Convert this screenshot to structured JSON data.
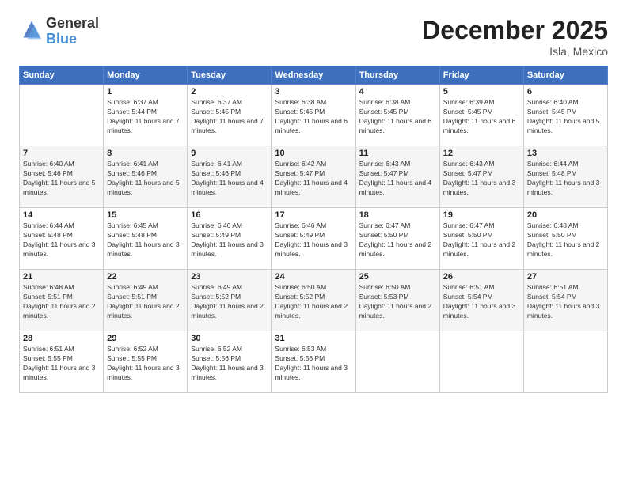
{
  "logo": {
    "general": "General",
    "blue": "Blue"
  },
  "title": "December 2025",
  "location": "Isla, Mexico",
  "days_header": [
    "Sunday",
    "Monday",
    "Tuesday",
    "Wednesday",
    "Thursday",
    "Friday",
    "Saturday"
  ],
  "weeks": [
    [
      {
        "day": "",
        "sunrise": "",
        "sunset": "",
        "daylight": ""
      },
      {
        "day": "1",
        "sunrise": "Sunrise: 6:37 AM",
        "sunset": "Sunset: 5:44 PM",
        "daylight": "Daylight: 11 hours and 7 minutes."
      },
      {
        "day": "2",
        "sunrise": "Sunrise: 6:37 AM",
        "sunset": "Sunset: 5:45 PM",
        "daylight": "Daylight: 11 hours and 7 minutes."
      },
      {
        "day": "3",
        "sunrise": "Sunrise: 6:38 AM",
        "sunset": "Sunset: 5:45 PM",
        "daylight": "Daylight: 11 hours and 6 minutes."
      },
      {
        "day": "4",
        "sunrise": "Sunrise: 6:38 AM",
        "sunset": "Sunset: 5:45 PM",
        "daylight": "Daylight: 11 hours and 6 minutes."
      },
      {
        "day": "5",
        "sunrise": "Sunrise: 6:39 AM",
        "sunset": "Sunset: 5:45 PM",
        "daylight": "Daylight: 11 hours and 6 minutes."
      },
      {
        "day": "6",
        "sunrise": "Sunrise: 6:40 AM",
        "sunset": "Sunset: 5:45 PM",
        "daylight": "Daylight: 11 hours and 5 minutes."
      }
    ],
    [
      {
        "day": "7",
        "sunrise": "Sunrise: 6:40 AM",
        "sunset": "Sunset: 5:46 PM",
        "daylight": "Daylight: 11 hours and 5 minutes."
      },
      {
        "day": "8",
        "sunrise": "Sunrise: 6:41 AM",
        "sunset": "Sunset: 5:46 PM",
        "daylight": "Daylight: 11 hours and 5 minutes."
      },
      {
        "day": "9",
        "sunrise": "Sunrise: 6:41 AM",
        "sunset": "Sunset: 5:46 PM",
        "daylight": "Daylight: 11 hours and 4 minutes."
      },
      {
        "day": "10",
        "sunrise": "Sunrise: 6:42 AM",
        "sunset": "Sunset: 5:47 PM",
        "daylight": "Daylight: 11 hours and 4 minutes."
      },
      {
        "day": "11",
        "sunrise": "Sunrise: 6:43 AM",
        "sunset": "Sunset: 5:47 PM",
        "daylight": "Daylight: 11 hours and 4 minutes."
      },
      {
        "day": "12",
        "sunrise": "Sunrise: 6:43 AM",
        "sunset": "Sunset: 5:47 PM",
        "daylight": "Daylight: 11 hours and 3 minutes."
      },
      {
        "day": "13",
        "sunrise": "Sunrise: 6:44 AM",
        "sunset": "Sunset: 5:48 PM",
        "daylight": "Daylight: 11 hours and 3 minutes."
      }
    ],
    [
      {
        "day": "14",
        "sunrise": "Sunrise: 6:44 AM",
        "sunset": "Sunset: 5:48 PM",
        "daylight": "Daylight: 11 hours and 3 minutes."
      },
      {
        "day": "15",
        "sunrise": "Sunrise: 6:45 AM",
        "sunset": "Sunset: 5:48 PM",
        "daylight": "Daylight: 11 hours and 3 minutes."
      },
      {
        "day": "16",
        "sunrise": "Sunrise: 6:46 AM",
        "sunset": "Sunset: 5:49 PM",
        "daylight": "Daylight: 11 hours and 3 minutes."
      },
      {
        "day": "17",
        "sunrise": "Sunrise: 6:46 AM",
        "sunset": "Sunset: 5:49 PM",
        "daylight": "Daylight: 11 hours and 3 minutes."
      },
      {
        "day": "18",
        "sunrise": "Sunrise: 6:47 AM",
        "sunset": "Sunset: 5:50 PM",
        "daylight": "Daylight: 11 hours and 2 minutes."
      },
      {
        "day": "19",
        "sunrise": "Sunrise: 6:47 AM",
        "sunset": "Sunset: 5:50 PM",
        "daylight": "Daylight: 11 hours and 2 minutes."
      },
      {
        "day": "20",
        "sunrise": "Sunrise: 6:48 AM",
        "sunset": "Sunset: 5:50 PM",
        "daylight": "Daylight: 11 hours and 2 minutes."
      }
    ],
    [
      {
        "day": "21",
        "sunrise": "Sunrise: 6:48 AM",
        "sunset": "Sunset: 5:51 PM",
        "daylight": "Daylight: 11 hours and 2 minutes."
      },
      {
        "day": "22",
        "sunrise": "Sunrise: 6:49 AM",
        "sunset": "Sunset: 5:51 PM",
        "daylight": "Daylight: 11 hours and 2 minutes."
      },
      {
        "day": "23",
        "sunrise": "Sunrise: 6:49 AM",
        "sunset": "Sunset: 5:52 PM",
        "daylight": "Daylight: 11 hours and 2 minutes."
      },
      {
        "day": "24",
        "sunrise": "Sunrise: 6:50 AM",
        "sunset": "Sunset: 5:52 PM",
        "daylight": "Daylight: 11 hours and 2 minutes."
      },
      {
        "day": "25",
        "sunrise": "Sunrise: 6:50 AM",
        "sunset": "Sunset: 5:53 PM",
        "daylight": "Daylight: 11 hours and 2 minutes."
      },
      {
        "day": "26",
        "sunrise": "Sunrise: 6:51 AM",
        "sunset": "Sunset: 5:54 PM",
        "daylight": "Daylight: 11 hours and 3 minutes."
      },
      {
        "day": "27",
        "sunrise": "Sunrise: 6:51 AM",
        "sunset": "Sunset: 5:54 PM",
        "daylight": "Daylight: 11 hours and 3 minutes."
      }
    ],
    [
      {
        "day": "28",
        "sunrise": "Sunrise: 6:51 AM",
        "sunset": "Sunset: 5:55 PM",
        "daylight": "Daylight: 11 hours and 3 minutes."
      },
      {
        "day": "29",
        "sunrise": "Sunrise: 6:52 AM",
        "sunset": "Sunset: 5:55 PM",
        "daylight": "Daylight: 11 hours and 3 minutes."
      },
      {
        "day": "30",
        "sunrise": "Sunrise: 6:52 AM",
        "sunset": "Sunset: 5:56 PM",
        "daylight": "Daylight: 11 hours and 3 minutes."
      },
      {
        "day": "31",
        "sunrise": "Sunrise: 6:53 AM",
        "sunset": "Sunset: 5:56 PM",
        "daylight": "Daylight: 11 hours and 3 minutes."
      },
      {
        "day": "",
        "sunrise": "",
        "sunset": "",
        "daylight": ""
      },
      {
        "day": "",
        "sunrise": "",
        "sunset": "",
        "daylight": ""
      },
      {
        "day": "",
        "sunrise": "",
        "sunset": "",
        "daylight": ""
      }
    ]
  ]
}
